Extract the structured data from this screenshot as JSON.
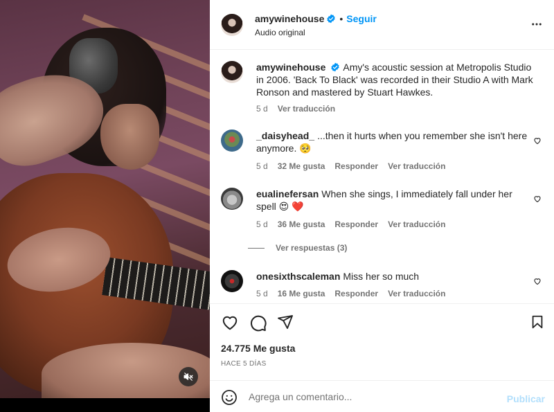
{
  "post": {
    "username": "amywinehouse",
    "follow_label": "Seguir",
    "dot": "•",
    "audio_label": "Audio original",
    "caption": "Amy's acoustic session at Metropolis Studio in 2006. 'Back To Black' was recorded in their Studio A with Mark Ronson and mastered by Stuart Hawkes.",
    "caption_age": "5 d",
    "translate_label": "Ver traducción"
  },
  "comments": [
    {
      "username": "_daisyhead_",
      "text": "...then it hurts when you remember she isn't here anymore. 🥺",
      "age": "5 d",
      "likes": "32 Me gusta",
      "reply_label": "Responder",
      "translate_label": "Ver traducción"
    },
    {
      "username": "eualinefersan",
      "text": "When she sings, I immediately fall under her spell 😍 ❤️",
      "age": "5 d",
      "likes": "36 Me gusta",
      "reply_label": "Responder",
      "translate_label": "Ver traducción",
      "replies_label": "Ver respuestas (3)"
    },
    {
      "username": "onesixthscaleman",
      "text": "Miss her so much",
      "age": "5 d",
      "likes": "16 Me gusta",
      "reply_label": "Responder",
      "translate_label": "Ver traducción"
    }
  ],
  "footer": {
    "likes_count": "24.775 Me gusta",
    "posted_ago": "HACE 5 DÍAS",
    "comment_placeholder": "Agrega un comentario...",
    "publish_label": "Publicar"
  },
  "icons": {
    "more": "more-options-icon",
    "verified": "verified-badge-icon",
    "like": "heart-icon",
    "comment": "comment-icon",
    "share": "share-icon",
    "save": "bookmark-icon",
    "emoji": "emoji-icon",
    "mute": "muted-speaker-icon"
  },
  "colors": {
    "accent": "#0095f6",
    "verified": "#0095f6",
    "publish_disabled": "#b2dffc",
    "heart_red": "#ed4956"
  }
}
